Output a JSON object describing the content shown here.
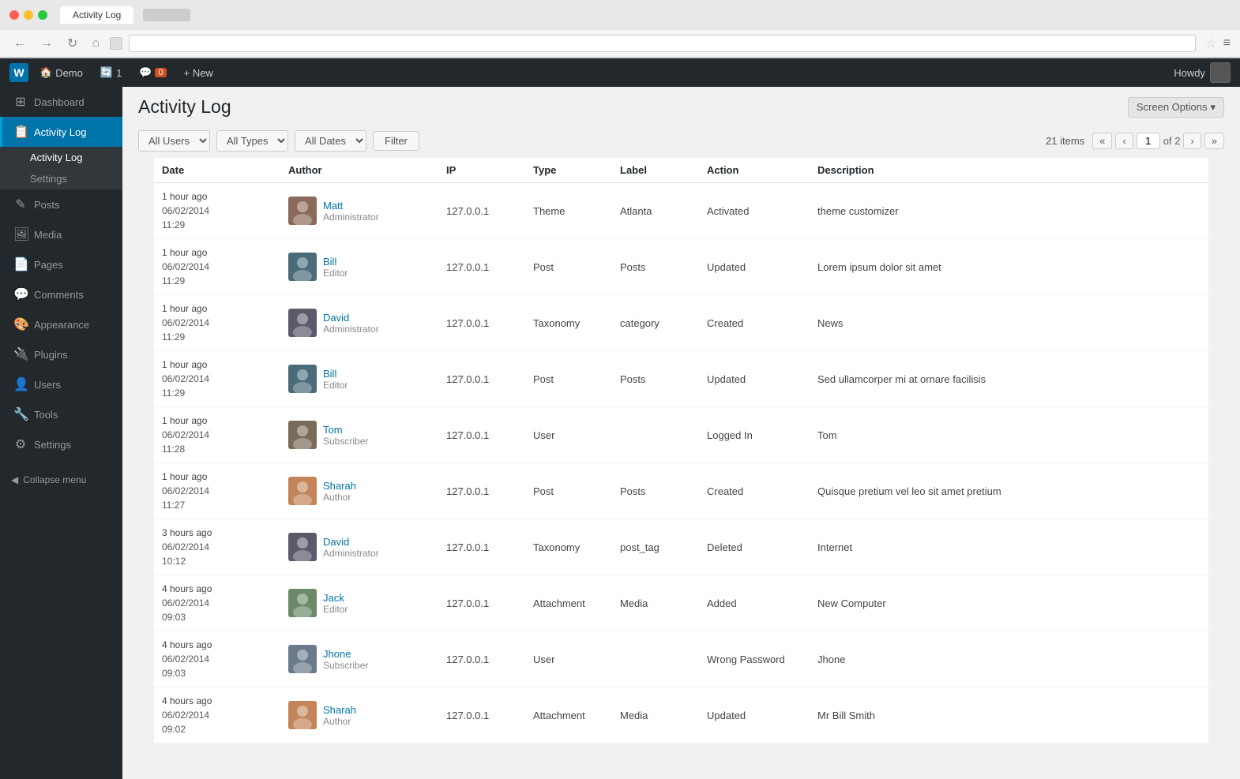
{
  "browser": {
    "tab_title": "Activity Log",
    "back_btn": "←",
    "forward_btn": "→",
    "reload_btn": "↻",
    "home_btn": "⌂",
    "address": "",
    "star": "☆",
    "menu": "≡"
  },
  "adminbar": {
    "wp_logo": "W",
    "site_name": "Demo",
    "updates": "1",
    "comments": "0",
    "new_label": "+ New",
    "howdy": "Howdy,",
    "username": "Howdy"
  },
  "sidebar": {
    "items": [
      {
        "id": "dashboard",
        "label": "Dashboard",
        "icon": "⊞"
      },
      {
        "id": "activity-log",
        "label": "Activity Log",
        "icon": "📋",
        "active": true
      },
      {
        "id": "activity-log-sub",
        "label": "Activity Log",
        "sub": true
      },
      {
        "id": "settings-sub",
        "label": "Settings",
        "sub": true
      },
      {
        "id": "posts",
        "label": "Posts",
        "icon": "✎"
      },
      {
        "id": "media",
        "label": "Media",
        "icon": "🖼"
      },
      {
        "id": "pages",
        "label": "Pages",
        "icon": "📄"
      },
      {
        "id": "comments",
        "label": "Comments",
        "icon": "💬"
      },
      {
        "id": "appearance",
        "label": "Appearance",
        "icon": "🎨"
      },
      {
        "id": "plugins",
        "label": "Plugins",
        "icon": "🔌"
      },
      {
        "id": "users",
        "label": "Users",
        "icon": "👤"
      },
      {
        "id": "tools",
        "label": "Tools",
        "icon": "🔧"
      },
      {
        "id": "settings",
        "label": "Settings",
        "icon": "⚙"
      }
    ],
    "collapse_label": "Collapse menu"
  },
  "page": {
    "title": "Activity Log",
    "screen_options": "Screen Options"
  },
  "filters": {
    "users_label": "All Users",
    "types_label": "All Types",
    "dates_label": "All Dates",
    "filter_btn": "Filter",
    "items_count": "21 items",
    "page_current": "1",
    "page_total": "of 2"
  },
  "table": {
    "headers": [
      "Date",
      "Author",
      "IP",
      "Type",
      "Label",
      "Action",
      "Description"
    ],
    "rows": [
      {
        "time_ago": "1 hour ago",
        "date": "06/02/2014",
        "time": "11:29",
        "author_name": "Matt",
        "author_role": "Administrator",
        "author_avatar": "👨",
        "ip": "127.0.0.1",
        "type": "Theme",
        "label": "Atlanta",
        "action": "Activated",
        "description": "theme customizer"
      },
      {
        "time_ago": "1 hour ago",
        "date": "06/02/2014",
        "time": "11:29",
        "author_name": "Bill",
        "author_role": "Editor",
        "author_avatar": "👨",
        "ip": "127.0.0.1",
        "type": "Post",
        "label": "Posts",
        "action": "Updated",
        "description": "Lorem ipsum dolor sit amet"
      },
      {
        "time_ago": "1 hour ago",
        "date": "06/02/2014",
        "time": "11:29",
        "author_name": "David",
        "author_role": "Administrator",
        "author_avatar": "👨",
        "ip": "127.0.0.1",
        "type": "Taxonomy",
        "label": "category",
        "action": "Created",
        "description": "News"
      },
      {
        "time_ago": "1 hour ago",
        "date": "06/02/2014",
        "time": "11:29",
        "author_name": "Bill",
        "author_role": "Editor",
        "author_avatar": "👨",
        "ip": "127.0.0.1",
        "type": "Post",
        "label": "Posts",
        "action": "Updated",
        "description": "Sed ullamcorper mi at ornare facilisis"
      },
      {
        "time_ago": "1 hour ago",
        "date": "06/02/2014",
        "time": "11:28",
        "author_name": "Tom",
        "author_role": "Subscriber",
        "author_avatar": "👨",
        "ip": "127.0.0.1",
        "type": "User",
        "label": "",
        "action": "Logged In",
        "description": "Tom"
      },
      {
        "time_ago": "1 hour ago",
        "date": "06/02/2014",
        "time": "11:27",
        "author_name": "Sharah",
        "author_role": "Author",
        "author_avatar": "👩",
        "ip": "127.0.0.1",
        "type": "Post",
        "label": "Posts",
        "action": "Created",
        "description": "Quisque pretium vel leo sit amet pretium"
      },
      {
        "time_ago": "3 hours ago",
        "date": "06/02/2014",
        "time": "10:12",
        "author_name": "David",
        "author_role": "Administrator",
        "author_avatar": "👨",
        "ip": "127.0.0.1",
        "type": "Taxonomy",
        "label": "post_tag",
        "action": "Deleted",
        "description": "Internet"
      },
      {
        "time_ago": "4 hours ago",
        "date": "06/02/2014",
        "time": "09:03",
        "author_name": "Jack",
        "author_role": "Editor",
        "author_avatar": "👨",
        "ip": "127.0.0.1",
        "type": "Attachment",
        "label": "Media",
        "action": "Added",
        "description": "New Computer"
      },
      {
        "time_ago": "4 hours ago",
        "date": "06/02/2014",
        "time": "09:03",
        "author_name": "Jhone",
        "author_role": "Subscriber",
        "author_avatar": "👨",
        "ip": "127.0.0.1",
        "type": "User",
        "label": "",
        "action": "Wrong Password",
        "description": "Jhone"
      },
      {
        "time_ago": "4 hours ago",
        "date": "06/02/2014",
        "time": "09:02",
        "author_name": "Sharah",
        "author_role": "Author",
        "author_avatar": "👩",
        "ip": "127.0.0.1",
        "type": "Attachment",
        "label": "Media",
        "action": "Updated",
        "description": "Mr Bill Smith"
      }
    ]
  }
}
